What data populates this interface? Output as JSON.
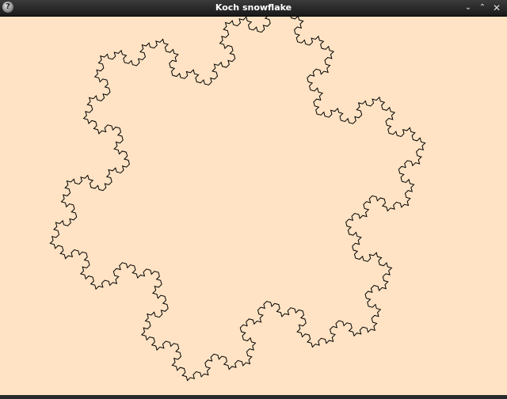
{
  "window": {
    "title": "Koch snowflake",
    "icon": "question-mark-icon",
    "icon_glyph": "?",
    "controls": [
      {
        "name": "minimize",
        "glyph": "⌄"
      },
      {
        "name": "maximize",
        "glyph": "⌃"
      },
      {
        "name": "close",
        "glyph": "✕"
      }
    ]
  },
  "colors": {
    "background": "#ffe3c4",
    "stroke": "#000000",
    "titlebar": "#262626",
    "title_text": "#ffffff"
  },
  "fractal": {
    "type": "koch-snowflake",
    "iterations": 4
  }
}
